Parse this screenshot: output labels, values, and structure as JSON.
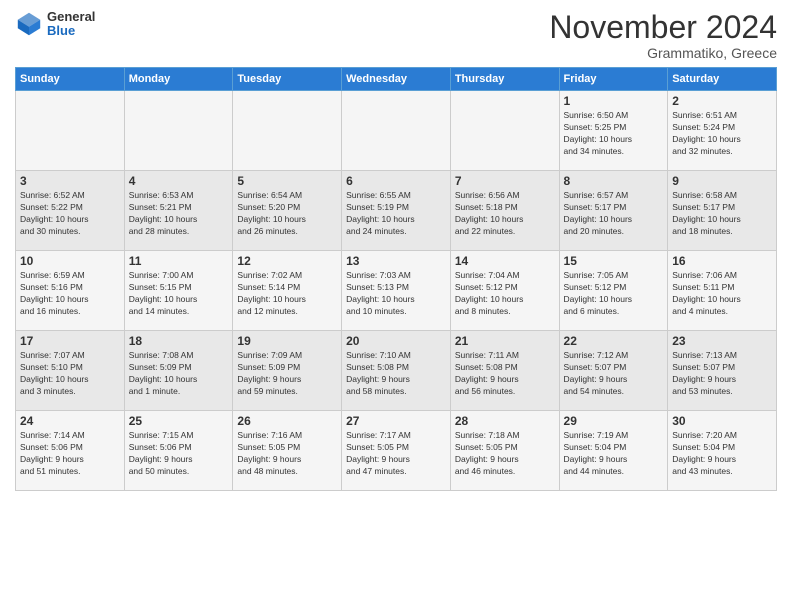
{
  "logo": {
    "general": "General",
    "blue": "Blue"
  },
  "title": "November 2024",
  "subtitle": "Grammatiko, Greece",
  "days_of_week": [
    "Sunday",
    "Monday",
    "Tuesday",
    "Wednesday",
    "Thursday",
    "Friday",
    "Saturday"
  ],
  "weeks": [
    [
      {
        "day": "",
        "info": ""
      },
      {
        "day": "",
        "info": ""
      },
      {
        "day": "",
        "info": ""
      },
      {
        "day": "",
        "info": ""
      },
      {
        "day": "",
        "info": ""
      },
      {
        "day": "1",
        "info": "Sunrise: 6:50 AM\nSunset: 5:25 PM\nDaylight: 10 hours\nand 34 minutes."
      },
      {
        "day": "2",
        "info": "Sunrise: 6:51 AM\nSunset: 5:24 PM\nDaylight: 10 hours\nand 32 minutes."
      }
    ],
    [
      {
        "day": "3",
        "info": "Sunrise: 6:52 AM\nSunset: 5:22 PM\nDaylight: 10 hours\nand 30 minutes."
      },
      {
        "day": "4",
        "info": "Sunrise: 6:53 AM\nSunset: 5:21 PM\nDaylight: 10 hours\nand 28 minutes."
      },
      {
        "day": "5",
        "info": "Sunrise: 6:54 AM\nSunset: 5:20 PM\nDaylight: 10 hours\nand 26 minutes."
      },
      {
        "day": "6",
        "info": "Sunrise: 6:55 AM\nSunset: 5:19 PM\nDaylight: 10 hours\nand 24 minutes."
      },
      {
        "day": "7",
        "info": "Sunrise: 6:56 AM\nSunset: 5:18 PM\nDaylight: 10 hours\nand 22 minutes."
      },
      {
        "day": "8",
        "info": "Sunrise: 6:57 AM\nSunset: 5:17 PM\nDaylight: 10 hours\nand 20 minutes."
      },
      {
        "day": "9",
        "info": "Sunrise: 6:58 AM\nSunset: 5:17 PM\nDaylight: 10 hours\nand 18 minutes."
      }
    ],
    [
      {
        "day": "10",
        "info": "Sunrise: 6:59 AM\nSunset: 5:16 PM\nDaylight: 10 hours\nand 16 minutes."
      },
      {
        "day": "11",
        "info": "Sunrise: 7:00 AM\nSunset: 5:15 PM\nDaylight: 10 hours\nand 14 minutes."
      },
      {
        "day": "12",
        "info": "Sunrise: 7:02 AM\nSunset: 5:14 PM\nDaylight: 10 hours\nand 12 minutes."
      },
      {
        "day": "13",
        "info": "Sunrise: 7:03 AM\nSunset: 5:13 PM\nDaylight: 10 hours\nand 10 minutes."
      },
      {
        "day": "14",
        "info": "Sunrise: 7:04 AM\nSunset: 5:12 PM\nDaylight: 10 hours\nand 8 minutes."
      },
      {
        "day": "15",
        "info": "Sunrise: 7:05 AM\nSunset: 5:12 PM\nDaylight: 10 hours\nand 6 minutes."
      },
      {
        "day": "16",
        "info": "Sunrise: 7:06 AM\nSunset: 5:11 PM\nDaylight: 10 hours\nand 4 minutes."
      }
    ],
    [
      {
        "day": "17",
        "info": "Sunrise: 7:07 AM\nSunset: 5:10 PM\nDaylight: 10 hours\nand 3 minutes."
      },
      {
        "day": "18",
        "info": "Sunrise: 7:08 AM\nSunset: 5:09 PM\nDaylight: 10 hours\nand 1 minute."
      },
      {
        "day": "19",
        "info": "Sunrise: 7:09 AM\nSunset: 5:09 PM\nDaylight: 9 hours\nand 59 minutes."
      },
      {
        "day": "20",
        "info": "Sunrise: 7:10 AM\nSunset: 5:08 PM\nDaylight: 9 hours\nand 58 minutes."
      },
      {
        "day": "21",
        "info": "Sunrise: 7:11 AM\nSunset: 5:08 PM\nDaylight: 9 hours\nand 56 minutes."
      },
      {
        "day": "22",
        "info": "Sunrise: 7:12 AM\nSunset: 5:07 PM\nDaylight: 9 hours\nand 54 minutes."
      },
      {
        "day": "23",
        "info": "Sunrise: 7:13 AM\nSunset: 5:07 PM\nDaylight: 9 hours\nand 53 minutes."
      }
    ],
    [
      {
        "day": "24",
        "info": "Sunrise: 7:14 AM\nSunset: 5:06 PM\nDaylight: 9 hours\nand 51 minutes."
      },
      {
        "day": "25",
        "info": "Sunrise: 7:15 AM\nSunset: 5:06 PM\nDaylight: 9 hours\nand 50 minutes."
      },
      {
        "day": "26",
        "info": "Sunrise: 7:16 AM\nSunset: 5:05 PM\nDaylight: 9 hours\nand 48 minutes."
      },
      {
        "day": "27",
        "info": "Sunrise: 7:17 AM\nSunset: 5:05 PM\nDaylight: 9 hours\nand 47 minutes."
      },
      {
        "day": "28",
        "info": "Sunrise: 7:18 AM\nSunset: 5:05 PM\nDaylight: 9 hours\nand 46 minutes."
      },
      {
        "day": "29",
        "info": "Sunrise: 7:19 AM\nSunset: 5:04 PM\nDaylight: 9 hours\nand 44 minutes."
      },
      {
        "day": "30",
        "info": "Sunrise: 7:20 AM\nSunset: 5:04 PM\nDaylight: 9 hours\nand 43 minutes."
      }
    ]
  ]
}
